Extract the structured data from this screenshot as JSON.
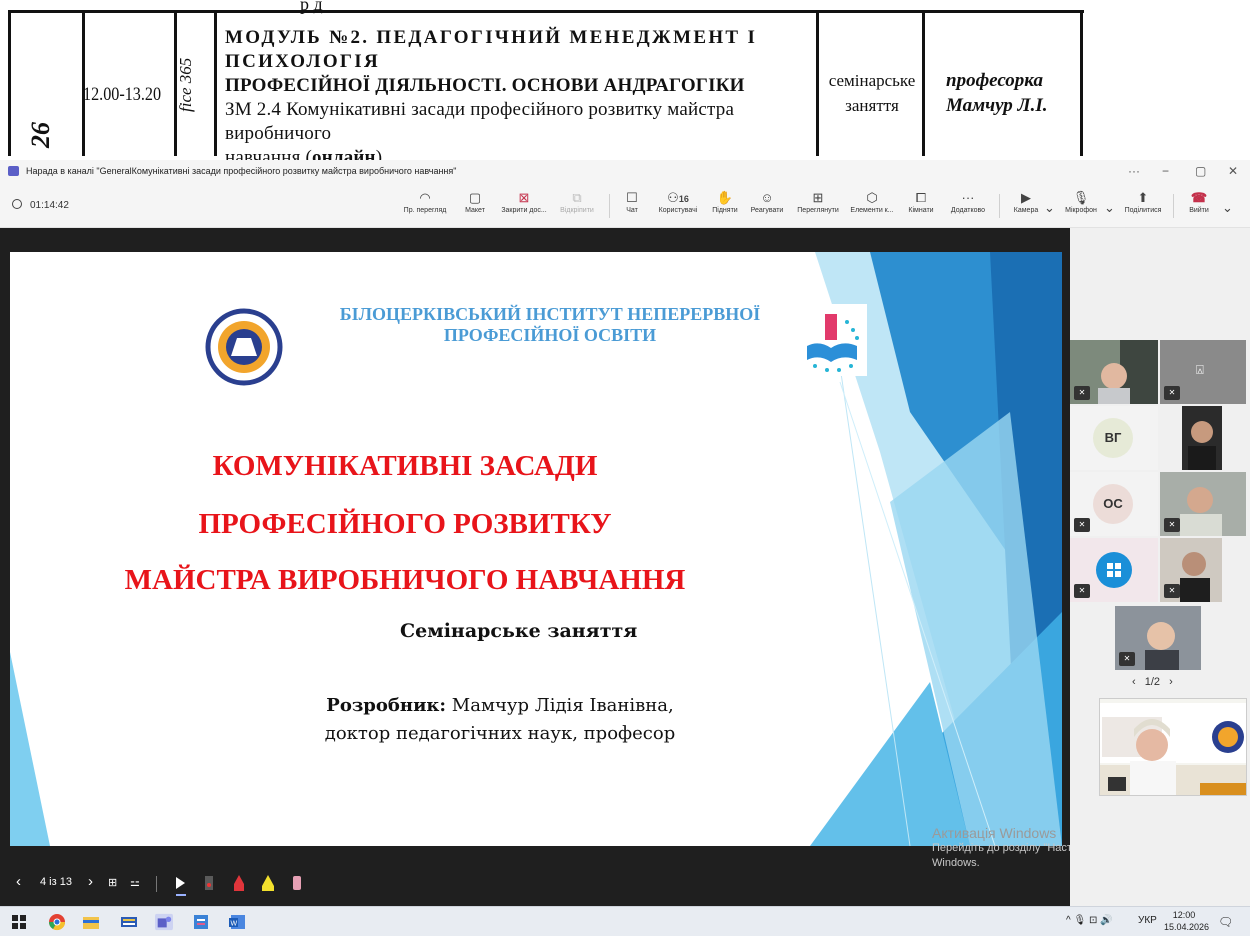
{
  "document": {
    "top_fragment": "р                                                  д",
    "time": "12.00-13.20",
    "rotated_left": "26",
    "rotated_room": "fice 365",
    "module_line1": "МОДУЛЬ  №2.  ПЕДАГОГІЧНИЙ  МЕНЕДЖМЕНТ  І  ПСИХОЛОГІЯ",
    "module_line2": "ПРОФЕСІЙНОЇ ДІЯЛЬНОСТІ. ОСНОВИ АНДРАГОГІКИ",
    "module_line3": "ЗМ 2.4 Комунікативні засади професійного розвитку майстра виробничого",
    "module_line4_a": "навчання (",
    "module_line4_b": "онлайн",
    "module_line4_c": ")",
    "type_line1": "семінарське",
    "type_line2": "заняття",
    "prof_line1": "професорка",
    "prof_line2": "Мамчур Л.І."
  },
  "window": {
    "title": "Нарада в каналі \"GeneralКомунікативні засади професійного розвитку майстра виробничого навчання\"",
    "more": "···",
    "minimize": "−",
    "restore": "▢",
    "close": "✕"
  },
  "toolbar": {
    "timer": "01:14:42",
    "buttons": [
      {
        "label": "Пр. перегляд",
        "icon": "◠"
      },
      {
        "label": "Макет",
        "icon": "▢"
      },
      {
        "label": "Закрити дос...",
        "icon": "⊠"
      },
      {
        "label": "Відкріпити",
        "icon": "⧉"
      },
      {
        "label": "Чат",
        "icon": "☐"
      },
      {
        "label": "Користувачі",
        "icon": "⚇",
        "count": "16"
      },
      {
        "label": "Підняти",
        "icon": "✋"
      },
      {
        "label": "Реагувати",
        "icon": "☺"
      },
      {
        "label": "Переглянути",
        "icon": "⊞"
      },
      {
        "label": "Елементи к...",
        "icon": "⬡"
      },
      {
        "label": "Кімнати",
        "icon": "⧠"
      },
      {
        "label": "Додатково",
        "icon": "···"
      },
      {
        "label": "Камера",
        "icon": "▶"
      },
      {
        "label": "Мікрофон",
        "icon": "🎙"
      },
      {
        "label": "Поділитися",
        "icon": "⬆"
      },
      {
        "label": "Вийти",
        "icon": "☎"
      }
    ]
  },
  "slide": {
    "institute_line1": "БІЛОЦЕРКІВСЬКИЙ ІНСТИТУТ НЕПЕРЕРВНОЇ",
    "institute_line2": "ПРОФЕСІЙНОЇ ОСВІТИ",
    "title_line1": "КОМУНІКАТИВНІ ЗАСАДИ",
    "title_line2": "ПРОФЕСІЙНОГО РОЗВИТКУ",
    "title_line3": "МАЙСТРА ВИРОБНИЧОГО НАВЧАННЯ",
    "subtitle": "Семінарське заняття",
    "author_label": "Розробник:",
    "author_name": " Мамчур Лідія Іванівна,",
    "author_degree": "доктор педагогічних наук, професор",
    "accent_color": "#e8141a",
    "institute_color": "#4a9bd5"
  },
  "slide_controls": {
    "prev": "‹",
    "page": "4 із 13",
    "next": "›",
    "grid": "⊞",
    "settings": "⚍"
  },
  "watermark": {
    "line1": "Активація Windows",
    "line2": "Перейдіть до розділу \"Настройки\", щоб активувати",
    "line3": "Windows."
  },
  "gallery": {
    "initials_vg": "ВГ",
    "initials_os": "ОС",
    "pager_prev": "‹",
    "pager": "1/2",
    "pager_next": "›"
  },
  "taskbar": {
    "lang": "УКР",
    "time": "12:00",
    "date": "15.04.2026",
    "tray_icons": "^  🎙  ⊡  🔊"
  }
}
